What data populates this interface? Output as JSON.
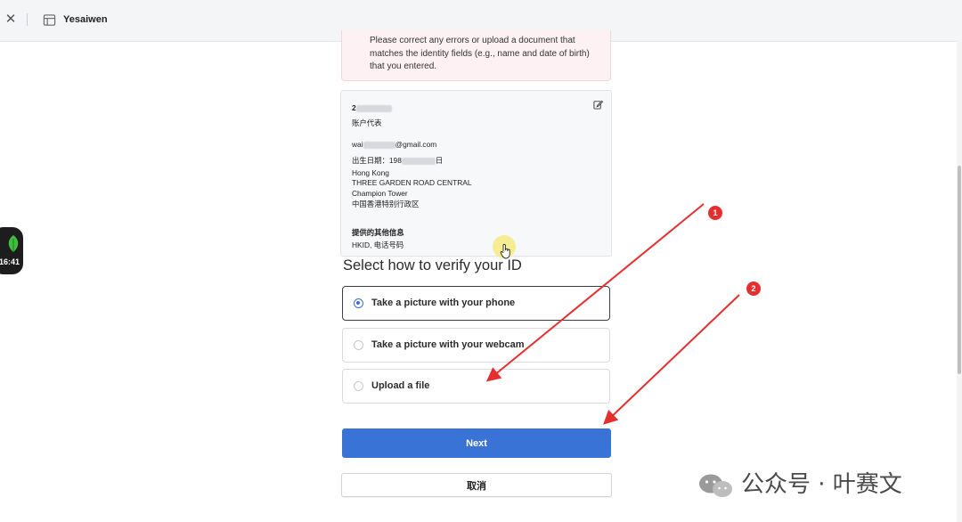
{
  "tab": {
    "close_symbol": "✕",
    "site_title": "Yesaiwen",
    "site_icon": "storefront-icon"
  },
  "clock": {
    "time": "16:41"
  },
  "alert": {
    "text": "Please correct any errors or upload a document that matches the identity fields (e.g., name and date of birth) that you entered."
  },
  "card": {
    "name_prefix": "2",
    "role": "账户代表",
    "email_prefix": "wai",
    "email_suffix": "@gmail.com",
    "dob_prefix": "出生日期：198",
    "dob_suffix": "日",
    "address": [
      "Hong Kong",
      "THREE GARDEN ROAD CENTRAL",
      "Champion Tower",
      "中国香港特别行政区"
    ],
    "other_info_title": "提供的其他信息",
    "other_info_value": "HKID, 电话号码"
  },
  "verify": {
    "heading": "Select how to verify your ID",
    "options": [
      {
        "label": "Take a picture with your phone",
        "selected": true
      },
      {
        "label": "Take a picture with your webcam",
        "selected": false
      },
      {
        "label": "Upload a file",
        "selected": false
      }
    ]
  },
  "buttons": {
    "next": "Next",
    "cancel": "取消"
  },
  "annotations": {
    "badge_1": "1",
    "badge_2": "2",
    "color": "#e52f2f"
  },
  "watermark": {
    "text": "公众号 · 叶赛文"
  },
  "colors": {
    "primary": "#3a73d6",
    "alert_bg": "#fdf1f3",
    "card_bg": "#f6f8fa"
  }
}
